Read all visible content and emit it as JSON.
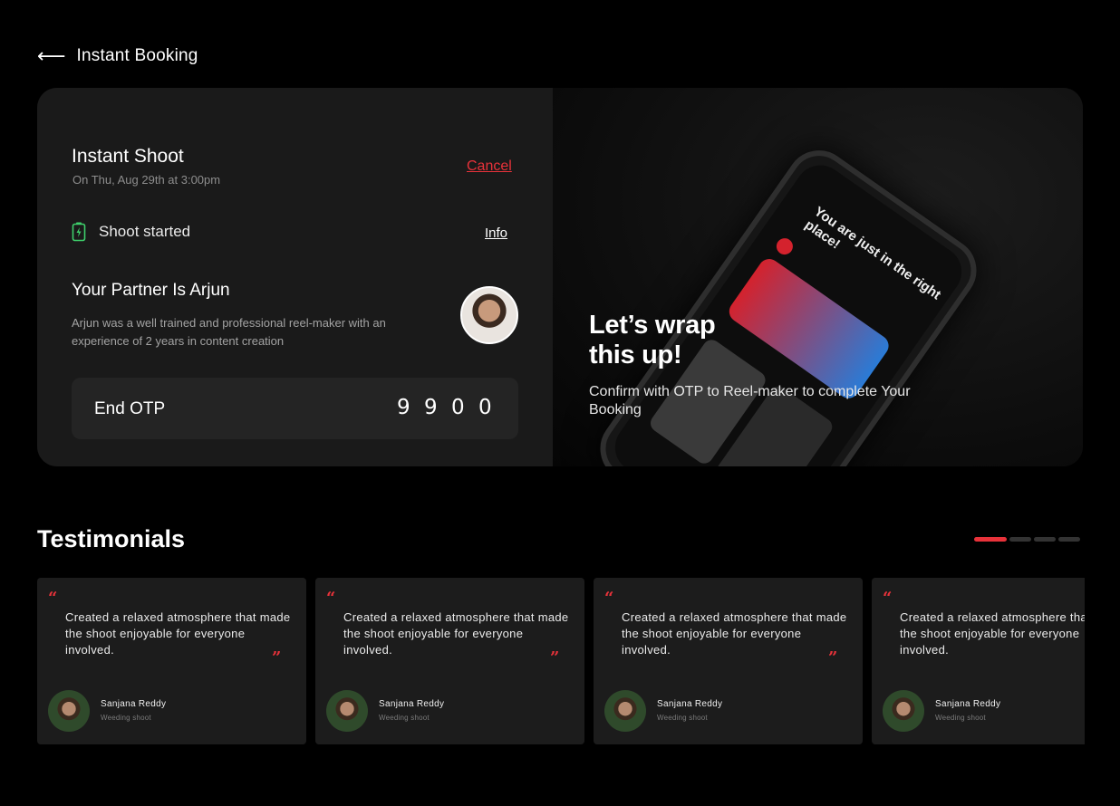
{
  "header": {
    "back_icon": "arrow-left-icon",
    "title": "Instant Booking"
  },
  "booking": {
    "shoot_title": "Instant Shoot",
    "shoot_date": "On Thu, Aug 29th at 3:00pm",
    "cancel_label": "Cancel",
    "status_icon": "battery-charging-icon",
    "status_text": "Shoot started",
    "info_label": "Info",
    "partner_title": "Your Partner Is Arjun",
    "partner_desc": "Arjun was a well trained and professional reel-maker with an experience of 2 years in content creation",
    "otp_label": "End OTP",
    "otp_digits": [
      "9",
      "9",
      "0",
      "0"
    ]
  },
  "promo": {
    "title_line1": "Let’s wrap",
    "title_line2": "this up!",
    "subtitle": "Confirm with OTP to Reel-maker to complete Your Booking",
    "phone_greeting": "You are just in the right place!"
  },
  "testimonials": {
    "title": "Testimonials",
    "pager_count": 4,
    "pager_active": 0,
    "accent_color": "#e8323a",
    "open_quote": "“",
    "close_quote": "”",
    "items": [
      {
        "quote": "Created a relaxed atmosphere that made the shoot enjoyable for everyone involved.",
        "name": "Sanjana Reddy",
        "role": "Weeding shoot"
      },
      {
        "quote": "Created a relaxed atmosphere that made the shoot enjoyable for everyone involved.",
        "name": "Sanjana Reddy",
        "role": "Weeding shoot"
      },
      {
        "quote": "Created a relaxed atmosphere that made the shoot enjoyable for everyone involved.",
        "name": "Sanjana Reddy",
        "role": "Weeding shoot"
      },
      {
        "quote": "Created a relaxed atmosphere that made the shoot enjoyable for everyone involved.",
        "name": "Sanjana Reddy",
        "role": "Weeding shoot"
      }
    ]
  }
}
